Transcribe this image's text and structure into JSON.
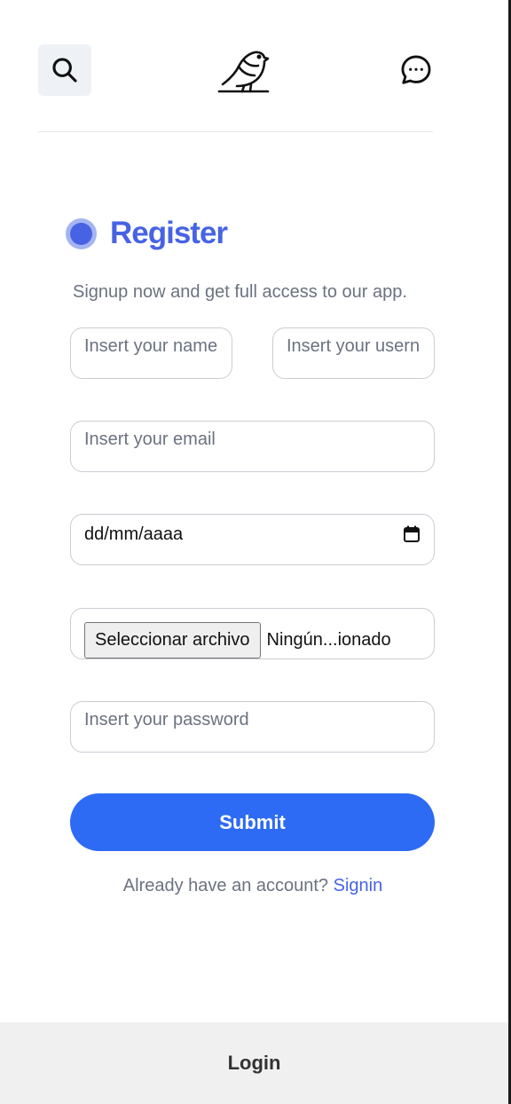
{
  "header": {
    "search_icon": "search-icon",
    "logo_icon": "bird-logo-icon",
    "chat_icon": "chat-bubble-icon"
  },
  "register": {
    "title": "Register",
    "subtitle": "Signup now and get full access to our app.",
    "accent_color": "#4763e4"
  },
  "form": {
    "name_placeholder": "Insert your name",
    "username_placeholder": "Insert your username",
    "email_placeholder": "Insert your email",
    "date_value": "dd/mm/aaaa",
    "file_button_label": "Seleccionar archivo",
    "file_status": "Ningún...ionado",
    "password_placeholder": "Insert your password",
    "submit_label": "Submit",
    "submit_color": "#2d6bf5"
  },
  "signin": {
    "prompt": "Already have an account?",
    "link_label": "Signin"
  },
  "bottom_bar": {
    "login_label": "Login"
  }
}
